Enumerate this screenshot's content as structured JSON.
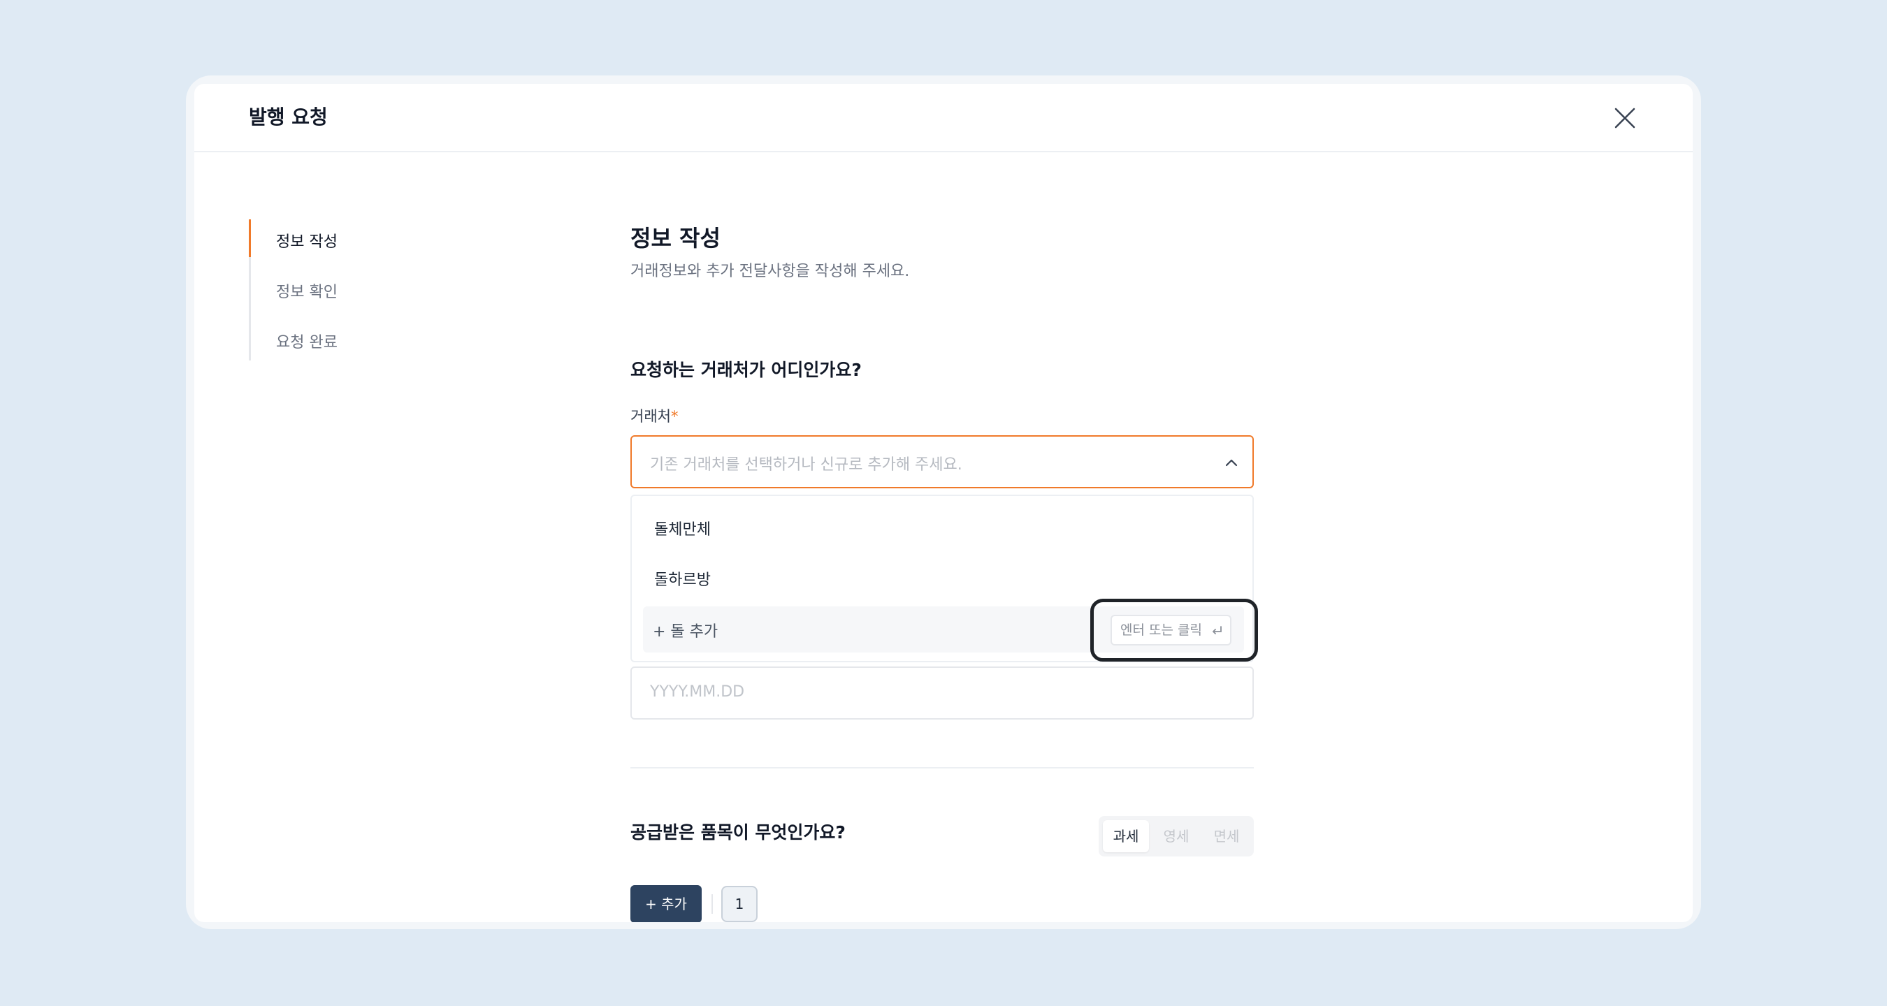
{
  "modal": {
    "title": "발행 요청"
  },
  "stepper": {
    "steps": [
      {
        "label": "정보 작성",
        "active": true
      },
      {
        "label": "정보 확인",
        "active": false
      },
      {
        "label": "요청 완료",
        "active": false
      }
    ]
  },
  "section": {
    "title": "정보 작성",
    "subtitle": "거래정보와 추가 전달사항을 작성해 주세요."
  },
  "question1": "요청하는 거래처가 어디인가요?",
  "partner_field": {
    "label": "거래처",
    "required_mark": "*",
    "placeholder": "기존 거래처를 선택하거나 신규로 추가해 주세요.",
    "options": [
      "돌체만체",
      "돌하르방"
    ],
    "add_option": "+ 돌 추가",
    "enter_hint": "엔터 또는 클릭"
  },
  "date_field": {
    "placeholder": "YYYY.MM.DD"
  },
  "question2": "공급받은 품목이 무엇인가요?",
  "tax_types": [
    "과세",
    "영세",
    "면세"
  ],
  "selected_tax_type": "과세",
  "add_button": "+ 추가",
  "page_chip": "1",
  "colors": {
    "accent": "#f07a2a",
    "primary_button": "#2d4360",
    "background": "#dfeaf4"
  },
  "icons": [
    "close-icon",
    "chevron-up-icon",
    "enter-key-icon"
  ]
}
